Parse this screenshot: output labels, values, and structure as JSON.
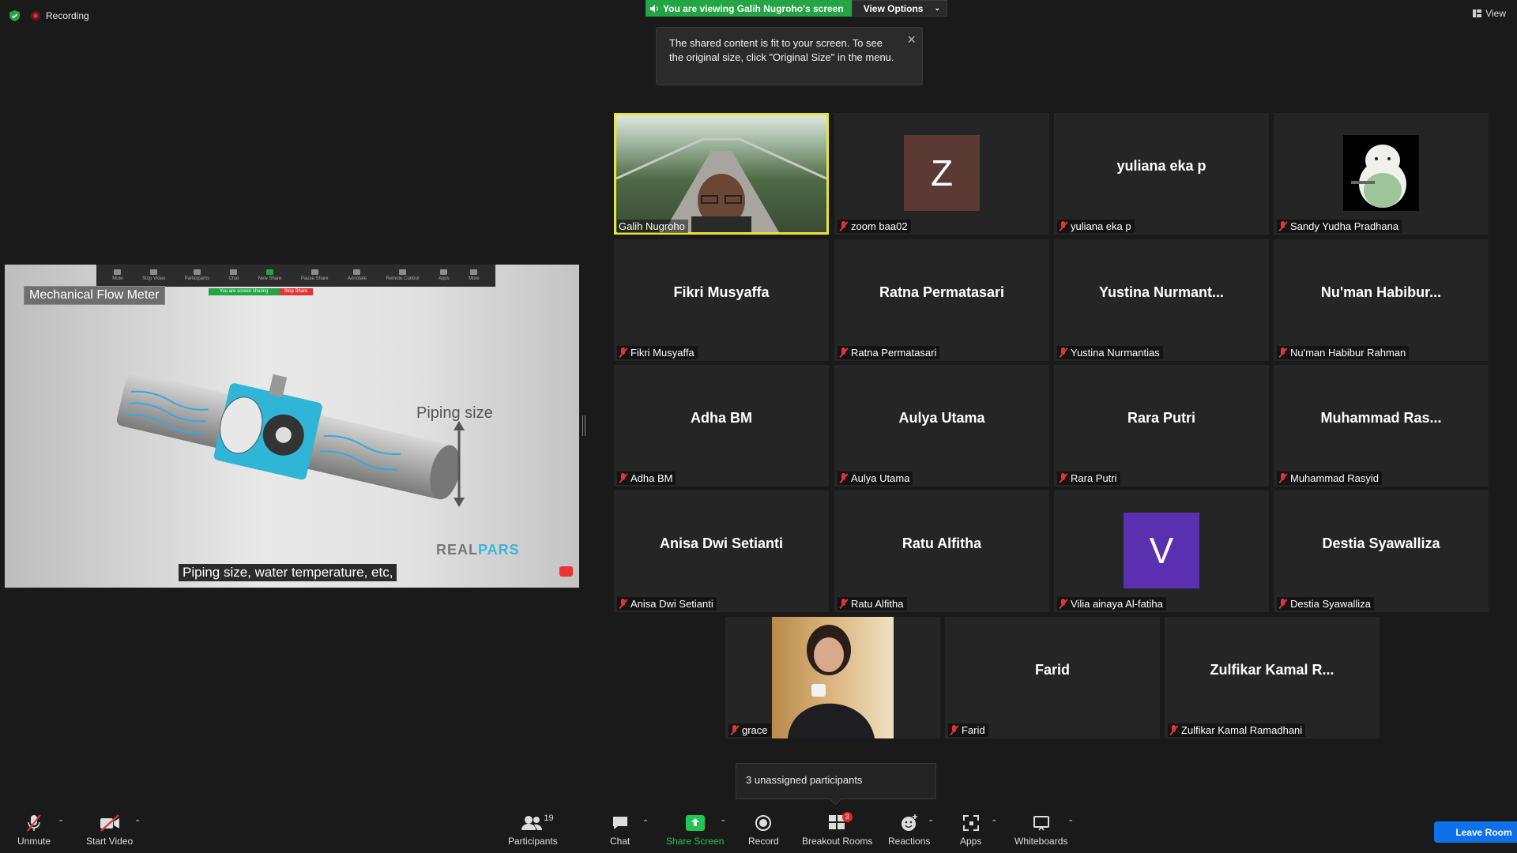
{
  "top": {
    "recording": "Recording",
    "share_banner": "You are viewing Galih Nugroho's screen",
    "view_options": "View Options",
    "view": "View"
  },
  "tooltip": {
    "text": "The shared content is fit to your screen. To see the original size, click \"Original Size\" in the menu."
  },
  "shared_screen": {
    "mini_toolbar": [
      "Mute",
      "Stop Video",
      "Participants",
      "Chat",
      "New Share",
      "Pause Share",
      "Annotate",
      "Remote Control",
      "Apps",
      "More"
    ],
    "mini_sharing": "You are screen sharing",
    "mini_stop": "Stop Share",
    "slide_title": "Mechanical Flow Meter",
    "piping_label": "Piping size",
    "logo_a": "REAL",
    "logo_b": "PARS",
    "caption": "Piping size, water temperature, etc,"
  },
  "participants": [
    {
      "name": "Galih Nugroho",
      "display": "",
      "avatar": "",
      "avatar_color": "",
      "active": true
    },
    {
      "name": "zoom baa02",
      "display": "",
      "avatar": "Z",
      "avatar_color": "#5a3a32"
    },
    {
      "name": "yuliana eka p",
      "display": "yuliana eka p",
      "avatar": "",
      "avatar_color": ""
    },
    {
      "name": "Sandy Yudha Pradhana",
      "display": "",
      "avatar": "",
      "avatar_color": ""
    },
    {
      "name": "Fikri Musyaffa",
      "display": "Fikri Musyaffa"
    },
    {
      "name": "Ratna Permatasari",
      "display": "Ratna Permatasari"
    },
    {
      "name": "Yustina Nurmantias",
      "display": "Yustina  Nurmant..."
    },
    {
      "name": "Nu'man Habibur Rahman",
      "display": "Nu'man  Habibur..."
    },
    {
      "name": "Adha BM",
      "display": "Adha BM"
    },
    {
      "name": "Aulya Utama",
      "display": "Aulya Utama"
    },
    {
      "name": "Rara Putri",
      "display": "Rara Putri"
    },
    {
      "name": "Muhammad Rasyid",
      "display": "Muhammad  Ras..."
    },
    {
      "name": "Anisa Dwi Setianti",
      "display": "Anisa Dwi Setianti"
    },
    {
      "name": "Ratu Alfitha",
      "display": "Ratu Alfitha"
    },
    {
      "name": "Vilia ainaya Al-fatiha",
      "display": "",
      "avatar": "V",
      "avatar_color": "#5a2fb0"
    },
    {
      "name": "Destia Syawalliza",
      "display": "Destia Syawalliza"
    },
    {
      "name": "grace",
      "display": ""
    },
    {
      "name": "Farid",
      "display": "Farid"
    },
    {
      "name": "Zulfikar Kamal Ramadhani",
      "display": "Zulfikar  Kamal  R..."
    }
  ],
  "unassigned": "3 unassigned participants",
  "toolbar": {
    "unmute": "Unmute",
    "start_video": "Start Video",
    "participants": "Participants",
    "participants_count": "19",
    "chat": "Chat",
    "share_screen": "Share Screen",
    "record": "Record",
    "breakout_rooms": "Breakout Rooms",
    "breakout_badge": "3",
    "reactions": "Reactions",
    "apps": "Apps",
    "whiteboards": "Whiteboards",
    "leave": "Leave Room"
  },
  "colors": {
    "background": "#1a1a1a",
    "tile": "#252525",
    "active_speaker": "#e8e534",
    "share_green": "#23a544",
    "leave_blue": "#0e71eb",
    "muted_red": "#e03535"
  }
}
